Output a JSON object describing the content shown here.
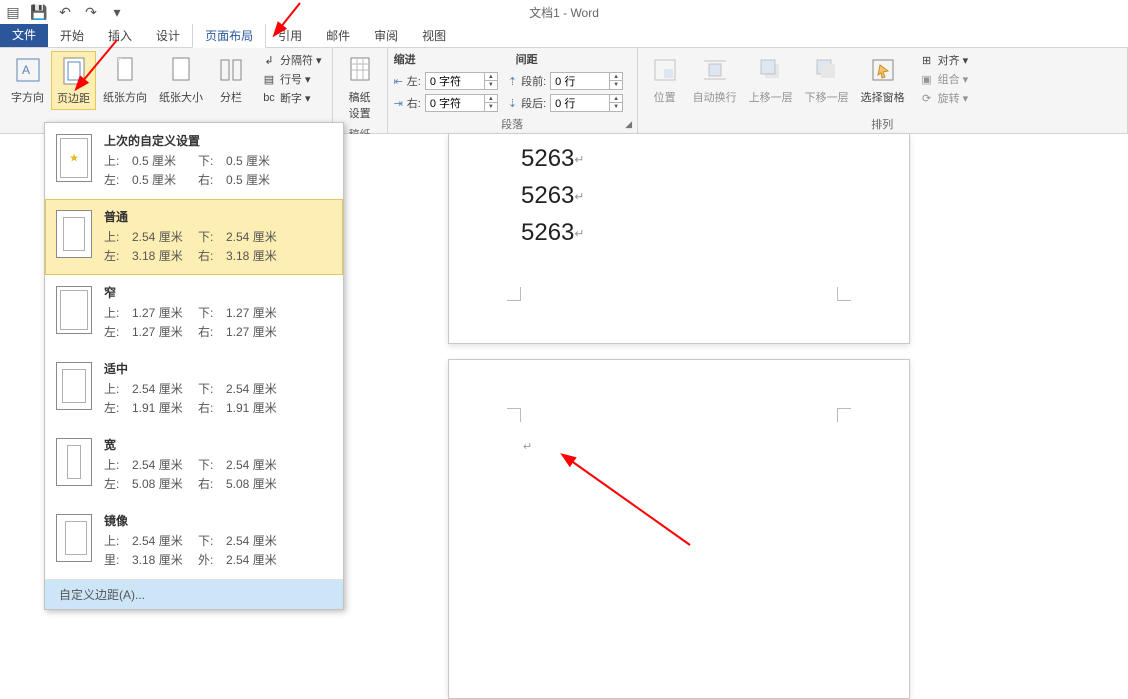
{
  "title": "文档1 - Word",
  "qat": {
    "undo_glyph": "↶",
    "redo_glyph": "↷",
    "save_glyph": "💾",
    "page_glyph": "▤"
  },
  "tabs": {
    "file": "文件",
    "home": "开始",
    "insert": "插入",
    "design": "设计",
    "layout": "页面布局",
    "references": "引用",
    "mailings": "邮件",
    "review": "审阅",
    "view": "视图"
  },
  "ribbon": {
    "page_setup": {
      "text_direction": "字方向",
      "margins": "页边距",
      "orientation": "纸张方向",
      "size": "纸张大小",
      "columns": "分栏",
      "breaks": "分隔符 ▾",
      "line_numbers": "行号 ▾",
      "hyphenation": "断字 ▾",
      "breaks_prefix": "↲",
      "ln_prefix": "▤",
      "hyph_prefix": "bc"
    },
    "manuscript": {
      "label": "稿纸",
      "settings": "稿纸\n设置"
    },
    "paragraph": {
      "group_label": "段落",
      "indent_header": "缩进",
      "spacing_header": "间距",
      "left_label": "左:",
      "right_label": "右:",
      "before_label": "段前:",
      "after_label": "段后:",
      "left_val": "0 字符",
      "right_val": "0 字符",
      "before_val": "0 行",
      "after_val": "0 行"
    },
    "arrange": {
      "group_label": "排列",
      "position": "位置",
      "wrap": "自动换行",
      "forward": "上移一层",
      "backward": "下移一层",
      "selection_pane": "选择窗格",
      "align": "对齐 ▾",
      "group": "组合 ▾",
      "rotate": "旋转 ▾"
    }
  },
  "margins_menu": {
    "items": [
      {
        "title": "上次的自定义设置",
        "top_l": "上:",
        "top_v": "0.5 厘米",
        "bot_l": "下:",
        "bot_v": "0.5 厘米",
        "left_l": "左:",
        "left_v": "0.5 厘米",
        "right_l": "右:",
        "right_v": "0.5 厘米"
      },
      {
        "title": "普通",
        "top_l": "上:",
        "top_v": "2.54 厘米",
        "bot_l": "下:",
        "bot_v": "2.54 厘米",
        "left_l": "左:",
        "left_v": "3.18 厘米",
        "right_l": "右:",
        "right_v": "3.18 厘米"
      },
      {
        "title": "窄",
        "top_l": "上:",
        "top_v": "1.27 厘米",
        "bot_l": "下:",
        "bot_v": "1.27 厘米",
        "left_l": "左:",
        "left_v": "1.27 厘米",
        "right_l": "右:",
        "right_v": "1.27 厘米"
      },
      {
        "title": "适中",
        "top_l": "上:",
        "top_v": "2.54 厘米",
        "bot_l": "下:",
        "bot_v": "2.54 厘米",
        "left_l": "左:",
        "left_v": "1.91 厘米",
        "right_l": "右:",
        "right_v": "1.91 厘米"
      },
      {
        "title": "宽",
        "top_l": "上:",
        "top_v": "2.54 厘米",
        "bot_l": "下:",
        "bot_v": "2.54 厘米",
        "left_l": "左:",
        "left_v": "5.08 厘米",
        "right_l": "右:",
        "right_v": "5.08 厘米"
      },
      {
        "title": "镜像",
        "top_l": "上:",
        "top_v": "2.54 厘米",
        "bot_l": "下:",
        "bot_v": "2.54 厘米",
        "left_l": "里:",
        "left_v": "3.18 厘米",
        "right_l": "外:",
        "right_v": "2.54 厘米"
      }
    ],
    "custom": "自定义边距(A)..."
  },
  "document": {
    "line1": "5263",
    "line2": "5263",
    "line3": "5263"
  }
}
